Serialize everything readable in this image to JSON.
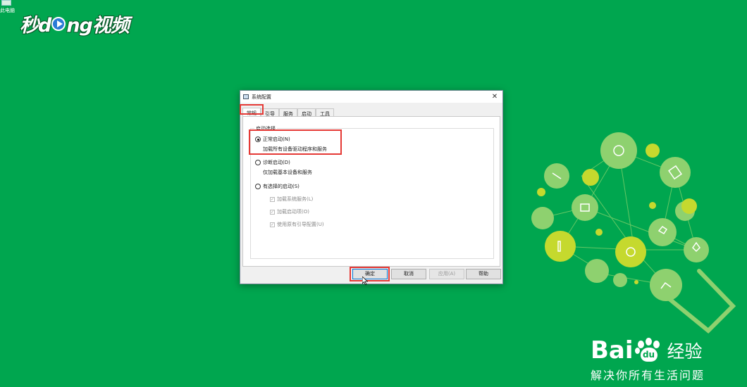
{
  "desktop": {
    "corner_icon_label": "此电脑",
    "video_logo": {
      "part1": "秒d",
      "part2": "ng视频"
    }
  },
  "dialog": {
    "title": "系统配置",
    "close_symbol": "✕",
    "tabs": [
      {
        "label": "常规",
        "active": true
      },
      {
        "label": "引导",
        "active": false
      },
      {
        "label": "服务",
        "active": false
      },
      {
        "label": "启动",
        "active": false
      },
      {
        "label": "工具",
        "active": false
      }
    ],
    "group_legend": "启动选择",
    "options": [
      {
        "label": "正常启动(N)",
        "description": "加载所有设备驱动程序和服务",
        "selected": true
      },
      {
        "label": "诊断启动(D)",
        "description": "仅加载基本设备和服务",
        "selected": false
      },
      {
        "label": "有选择的启动(S)",
        "selected": false
      }
    ],
    "selective_checks": [
      {
        "label": "加载系统服务(L)",
        "checked": true,
        "enabled": false
      },
      {
        "label": "加载启动项(O)",
        "checked": true,
        "enabled": false
      },
      {
        "label": "使用原有引导配置(U)",
        "checked": true,
        "enabled": false
      }
    ],
    "buttons": {
      "ok": "确定",
      "cancel": "取消",
      "apply": "应用(A)",
      "help": "帮助"
    }
  },
  "brand": {
    "name_left": "Bai",
    "name_paw": "du",
    "name_right": "经验",
    "slogan": "解决你所有生活问题"
  },
  "colors": {
    "background": "#00a64f",
    "highlight": "#e53935",
    "bulb_light": "#8ed16f",
    "bulb_yellow": "#c5d92e"
  }
}
